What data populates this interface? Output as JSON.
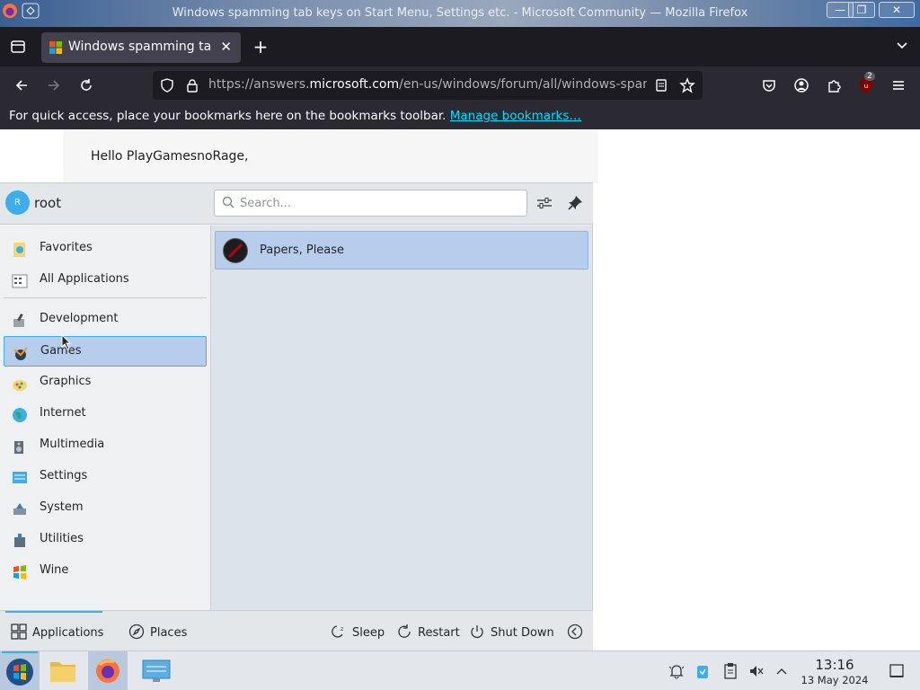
{
  "window": {
    "title": "Windows spamming tab keys on Start Menu, Settings etc. - Microsoft Community — Mozilla Firefox",
    "buttons": [
      "minimize",
      "maximize",
      "close"
    ]
  },
  "browser": {
    "tab": {
      "title": "Windows spamming tab keys on Start Menu, Settings etc. - Microsoft Community"
    },
    "url": {
      "prefix": "https://answers.",
      "domain": "microsoft.com",
      "path": "/en-us/windows/forum/all/windows-spamming-tab-keys"
    },
    "extension_badge": "2",
    "bookmarks_bar": {
      "message": "For quick access, place your bookmarks here on the bookmarks toolbar.",
      "link": "Manage bookmarks…"
    }
  },
  "page": {
    "greeting": "Hello PlayGamesnoRage,"
  },
  "menu": {
    "user": {
      "initial": "R",
      "name": "root"
    },
    "search": {
      "placeholder": "Search...",
      "value": ""
    },
    "categories": [
      {
        "label": "Favorites",
        "icon": "favorites-icon"
      },
      {
        "label": "All Applications",
        "icon": "all-applications-icon"
      },
      {
        "label": "Development",
        "icon": "development-icon"
      },
      {
        "label": "Games",
        "icon": "games-icon",
        "selected": true
      },
      {
        "label": "Graphics",
        "icon": "graphics-icon"
      },
      {
        "label": "Internet",
        "icon": "internet-icon"
      },
      {
        "label": "Multimedia",
        "icon": "multimedia-icon"
      },
      {
        "label": "Settings",
        "icon": "settings-icon"
      },
      {
        "label": "System",
        "icon": "system-icon"
      },
      {
        "label": "Utilities",
        "icon": "utilities-icon"
      },
      {
        "label": "Wine",
        "icon": "wine-icon"
      }
    ],
    "apps": [
      {
        "label": "Papers, Please",
        "icon": "papers-please-icon"
      }
    ],
    "footer": {
      "applications": "Applications",
      "places": "Places",
      "sleep": "Sleep",
      "restart": "Restart",
      "shutdown": "Shut Down"
    }
  },
  "taskbar": {
    "clock": {
      "time": "13:16",
      "date": "13 May 2024"
    }
  },
  "colors": {
    "accent": "#3daee9",
    "selection": "#b7cdec",
    "firefox_dark": "#1c1b22",
    "link": "#00ddff"
  }
}
